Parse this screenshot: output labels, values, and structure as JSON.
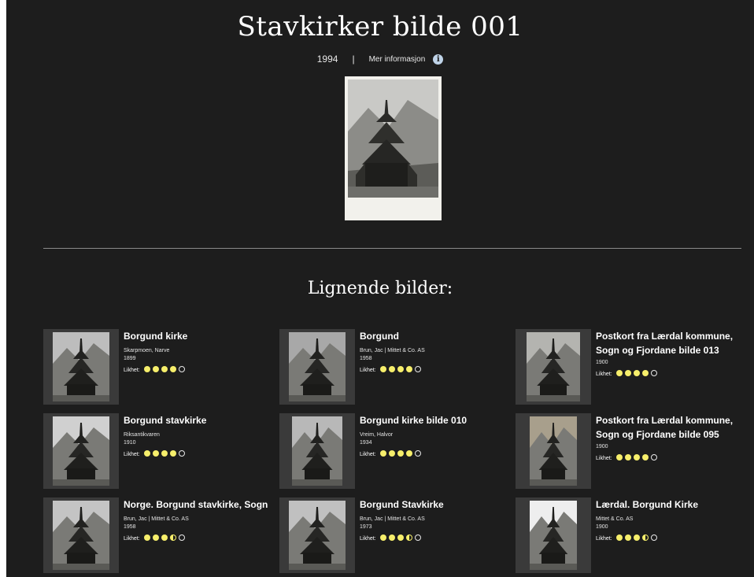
{
  "header": {
    "title": "Stavkirker bilde 001",
    "year": "1994",
    "separator": "|",
    "more_info": "Mer informasjon"
  },
  "section": {
    "title": "Lignende bilder:"
  },
  "rating_label": "Likhet:",
  "cards": [
    {
      "name": "Borgund kirke",
      "creator": "Skarpmoen, Narve",
      "year": "1899",
      "similarity": 4
    },
    {
      "name": "Borgund",
      "creator": "Brun, Jac | Mittet & Co. AS",
      "year": "1958",
      "similarity": 4
    },
    {
      "name": "Postkort fra Lærdal kommune, Sogn og Fjordane bilde 013",
      "creator": "",
      "year": "1900",
      "similarity": 4
    },
    {
      "name": "Borgund stavkirke",
      "creator": "Riksantikvaren",
      "year": "1910",
      "similarity": 4
    },
    {
      "name": "Borgund kirke bilde 010",
      "creator": "Vreim, Halvor",
      "year": "1934",
      "similarity": 4
    },
    {
      "name": "Postkort fra Lærdal kommune, Sogn og Fjordane bilde 095",
      "creator": "",
      "year": "1900",
      "similarity": 4
    },
    {
      "name": "Norge. Borgund stavkirke, Sogn",
      "creator": "Brun, Jac | Mittet & Co. AS",
      "year": "1958",
      "similarity": 3.5
    },
    {
      "name": "Borgund Stavkirke",
      "creator": "Brun, Jac | Mittet & Co. AS",
      "year": "1973",
      "similarity": 3.5
    },
    {
      "name": "Lærdal. Borgund Kirke",
      "creator": "Mittet & Co. AS",
      "year": "1900",
      "similarity": 3.5
    }
  ]
}
